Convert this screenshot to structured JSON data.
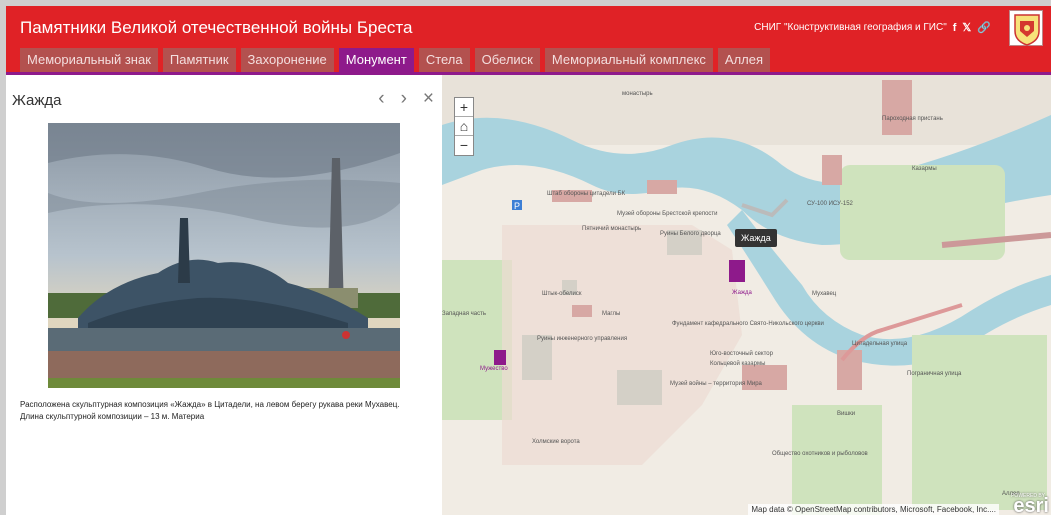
{
  "header": {
    "title": "Памятники Великой отечественной войны Бреста",
    "org": "СНИГ \"Конструктивная география и ГИС\"",
    "icons": [
      "facebook-icon",
      "twitter-icon",
      "link-icon"
    ],
    "brand_color": "#e02226",
    "accent_color": "#8e1a8b"
  },
  "tabs": [
    {
      "label": "Мемориальный знак",
      "active": false
    },
    {
      "label": "Памятник",
      "active": false
    },
    {
      "label": "Захоронение",
      "active": false
    },
    {
      "label": "Монумент",
      "active": true
    },
    {
      "label": "Стела",
      "active": false
    },
    {
      "label": "Обелиск",
      "active": false
    },
    {
      "label": "Мемориальный комплекс",
      "active": false
    },
    {
      "label": "Аллея",
      "active": false
    }
  ],
  "panel": {
    "title": "Жажда",
    "prev": "‹",
    "next": "›",
    "close": "×",
    "description": "Расположена скульптурная композиция «Жажда» в Цитадели, на левом берегу рукава реки Мухавец. Длина скульптурной композиции – 13 м. Материа"
  },
  "map": {
    "zoom_in": "+",
    "home": "⌂",
    "zoom_out": "−",
    "tooltip": "Жажда",
    "attribution": "Map data © OpenStreetMap contributors, Microsoft, Facebook, Inc....",
    "logo": "esri",
    "powered": "POWERED BY",
    "markers": [
      {
        "label": "Жажда"
      },
      {
        "label": "Мужество"
      }
    ],
    "labels": [
      "монастырь",
      "Пароходная пристань",
      "Казармы",
      "СУ-100 ИСУ-152",
      "Штаб обороны цитадели БК",
      "Музей обороны Брестской крепости",
      "Пятничий монастырь",
      "Руины Белого дворца",
      "Мухавец",
      "Штык-обелиск",
      "Фундамент кафедрального Свято-Никольского церкви",
      "Юго-восточный сектор",
      "Кольцевой казармы",
      "Музей войны – территория Мира",
      "Холмские ворота",
      "Общество охотников и рыболовов",
      "Вишки",
      "Пограничная улица",
      "Цитадельная улица",
      "Маглы",
      "Руины инженерного управления",
      "Западная часть",
      "Аллея"
    ]
  }
}
